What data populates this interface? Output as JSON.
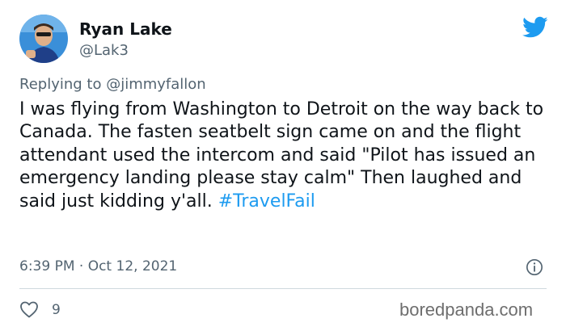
{
  "user": {
    "name": "Ryan Lake",
    "handle": "@Lak3"
  },
  "reply": {
    "prefix": "Replying to ",
    "mention": "@jimmyfallon"
  },
  "tweet": {
    "text": "I was flying from Washington to Detroit on the way back to Canada. The fasten seatbelt sign came on and the flight attendant used the intercom and said \"Pilot has issued an emergency landing please stay calm\" Then laughed and said just kidding y'all. ",
    "hashtag": "#TravelFail",
    "timestamp": "6:39 PM · Oct 12, 2021"
  },
  "stats": {
    "likes": "9"
  },
  "watermark": "boredpanda.com",
  "icons": {
    "logo": "twitter-bird-icon",
    "info": "info-circle-icon",
    "like": "heart-outline-icon"
  },
  "colors": {
    "twitter_blue": "#1d9bf0",
    "secondary_text": "#536471",
    "primary_text": "#0f1419"
  }
}
